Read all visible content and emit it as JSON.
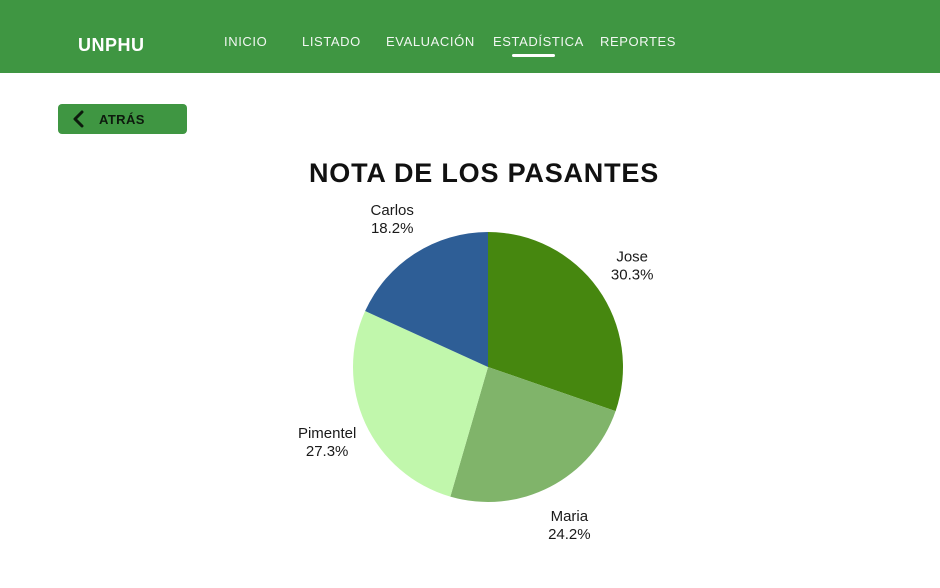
{
  "header": {
    "brand": "UNPHU",
    "nav": [
      {
        "label": "INICIO"
      },
      {
        "label": "LISTADO"
      },
      {
        "label": "EVALUACIÓN"
      },
      {
        "label": "ESTADÍSTICA",
        "active": true
      },
      {
        "label": "REPORTES"
      }
    ],
    "bg_color": "#3f9642"
  },
  "back_button": {
    "label": "ATRÁS",
    "icon": "chevron-left-icon"
  },
  "chart_data": {
    "type": "pie",
    "title": "NOTA DE LOS PASANTES",
    "slices": [
      {
        "label": "Jose",
        "value": 30.3,
        "display": "30.3%",
        "color": "#46870f"
      },
      {
        "label": "Maria",
        "value": 24.2,
        "display": "24.2%",
        "color": "#80b46a"
      },
      {
        "label": "Pimentel",
        "value": 27.3,
        "display": "27.3%",
        "color": "#c1f7ac"
      },
      {
        "label": "Carlos",
        "value": 18.2,
        "display": "18.2%",
        "color": "#2e5e96"
      }
    ]
  }
}
